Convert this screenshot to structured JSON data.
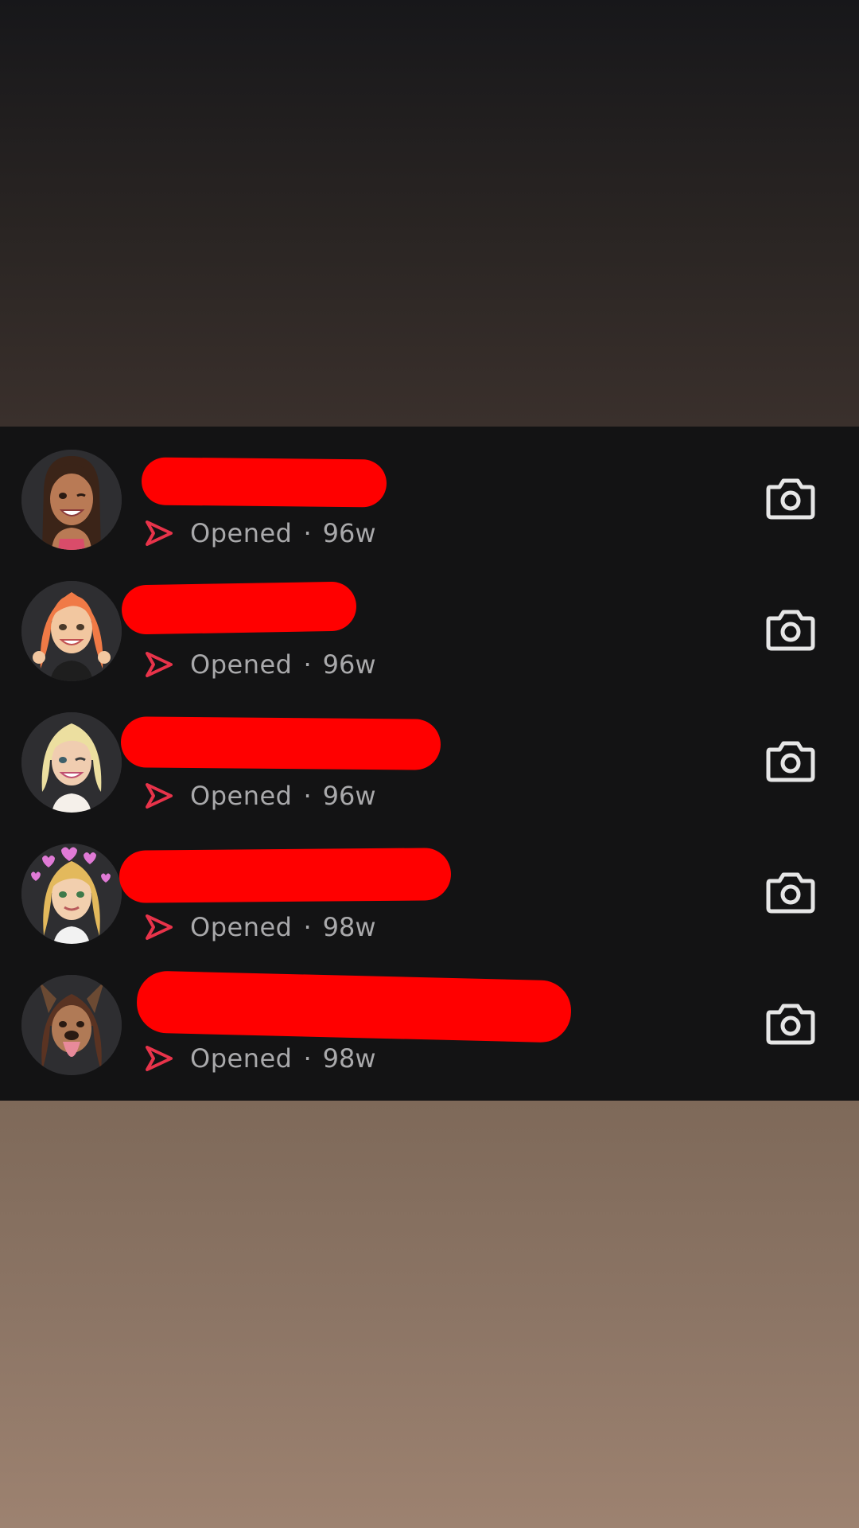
{
  "chats": [
    {
      "status": "Opened",
      "separator": "·",
      "age": "96w",
      "avatar": "avatar-dark-hair-wink",
      "camera_icon": "camera-icon"
    },
    {
      "status": "Opened",
      "separator": "·",
      "age": "96w",
      "avatar": "avatar-orange-hair",
      "camera_icon": "camera-icon"
    },
    {
      "status": "Opened",
      "separator": "·",
      "age": "96w",
      "avatar": "avatar-blonde-bob-wink",
      "camera_icon": "camera-icon"
    },
    {
      "status": "Opened",
      "separator": "·",
      "age": "98w",
      "avatar": "avatar-blonde-heart-crown",
      "camera_icon": "camera-icon"
    },
    {
      "status": "Opened",
      "separator": "·",
      "age": "98w",
      "avatar": "avatar-dog-filter",
      "camera_icon": "camera-icon"
    }
  ],
  "colors": {
    "list_background": "#131314",
    "sent_icon": "#e8334a",
    "status_text": "#a9a9ab",
    "redaction": "#ff0000",
    "camera_icon": "#e6e6e6"
  }
}
